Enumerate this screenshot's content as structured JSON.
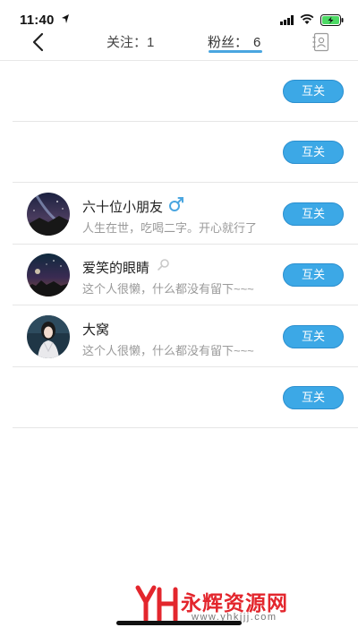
{
  "status_bar": {
    "time": "11:40"
  },
  "nav": {
    "following_label": "关注",
    "following_count": "1",
    "fans_label": "粉丝",
    "fans_count": "6",
    "active_tab": "fans",
    "accent_color": "#4aa6e0"
  },
  "fans": [
    {
      "name": "",
      "bio": "",
      "button_label": "互关"
    },
    {
      "name": "",
      "bio": "",
      "button_label": "互关"
    },
    {
      "name": "六十位小朋友",
      "bio": "人生在世，吃喝二字。开心就行了",
      "gender": "male",
      "avatar": "starry-night-landscape",
      "button_label": "互关"
    },
    {
      "name": "爱笑的眼睛",
      "bio": "这个人很懒，什么都没有留下~~~",
      "gender": "unknown",
      "avatar": "city-night-sky",
      "button_label": "互关"
    },
    {
      "name": "大窝",
      "bio": "这个人很懒，什么都没有留下~~~",
      "avatar": "woman-portrait",
      "button_label": "互关"
    },
    {
      "name": "",
      "bio": "",
      "button_label": "互关"
    }
  ],
  "button_color": "#3ca8e6",
  "watermark": {
    "text": "永辉资源网",
    "url": "www.yhkjjj.com"
  }
}
